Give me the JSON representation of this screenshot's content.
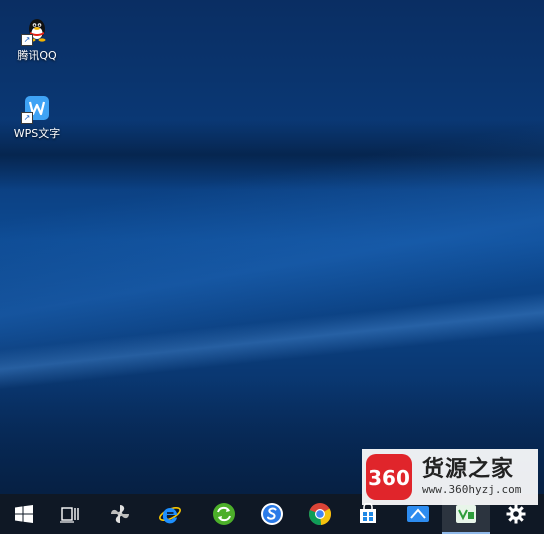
{
  "desktop": {
    "icons": [
      {
        "label": "腾讯QQ",
        "icon": "qq-penguin-icon"
      },
      {
        "label": "WPS文字",
        "icon": "wps-writer-icon"
      }
    ]
  },
  "taskbar": {
    "items": [
      {
        "icon": "windows-start-icon"
      },
      {
        "icon": "task-view-icon"
      },
      {
        "icon": "pinwheel-app-icon"
      },
      {
        "icon": "internet-explorer-icon"
      },
      {
        "icon": "green-refresh-app-icon"
      },
      {
        "icon": "sogou-browser-icon"
      },
      {
        "icon": "chrome-icon"
      },
      {
        "icon": "store-app-icon"
      },
      {
        "icon": "blue-app-icon"
      },
      {
        "icon": "green-document-app-icon",
        "active": true
      },
      {
        "icon": "settings-gear-icon"
      }
    ]
  },
  "watermark": {
    "logo_text": "360",
    "title": "货源之家",
    "url": "www.360hyzj.com"
  },
  "colors": {
    "taskbar_bg": "#101824",
    "wallpaper_blue": "#0d4a92",
    "logo_red": "#e0252b"
  }
}
